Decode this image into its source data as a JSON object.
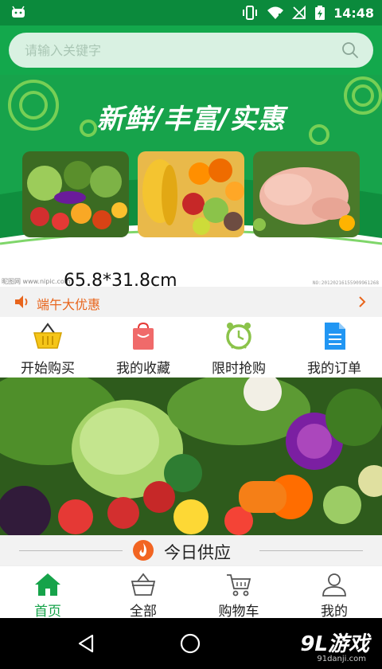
{
  "status_bar": {
    "time": "14:48",
    "icons": [
      "android-icon",
      "vibrate-icon",
      "wifi-icon",
      "no-signal-icon",
      "battery-charging-icon"
    ]
  },
  "search": {
    "placeholder": "请输入关键字",
    "icon": "search-icon"
  },
  "banner": {
    "title": "新鲜/丰富/实惠",
    "photos": [
      "vegetables-photo",
      "fruits-photo",
      "chicken-photo"
    ]
  },
  "caption_strip": {
    "left_text": "昵图网 www.nipic.com",
    "size_text": "65.8*31.8cm",
    "right_text": "NO:20120216155909961268"
  },
  "promo": {
    "icon": "speaker-icon",
    "text": "端午大优惠",
    "arrow": "chevron-right-icon"
  },
  "quick_menu": [
    {
      "label": "开始购买",
      "icon": "basket-icon"
    },
    {
      "label": "我的收藏",
      "icon": "bag-icon"
    },
    {
      "label": "限时抢购",
      "icon": "alarm-clock-icon"
    },
    {
      "label": "我的订单",
      "icon": "document-icon"
    }
  ],
  "today_supply": {
    "title": "今日供应",
    "icon": "flame-icon"
  },
  "bottom_nav": [
    {
      "label": "首页",
      "icon": "home-icon",
      "active": true
    },
    {
      "label": "全部",
      "icon": "basket-outline-icon",
      "active": false
    },
    {
      "label": "购物车",
      "icon": "cart-icon",
      "active": false
    },
    {
      "label": "我的",
      "icon": "user-icon",
      "active": false
    }
  ],
  "system_nav": {
    "watermark_logo": "9L游戏",
    "watermark_url": "91danji.com"
  },
  "colors": {
    "primary_green": "#13a84c",
    "status_green": "#0b8a3c",
    "promo_orange": "#e8651c",
    "active_nav": "#16a34a"
  }
}
